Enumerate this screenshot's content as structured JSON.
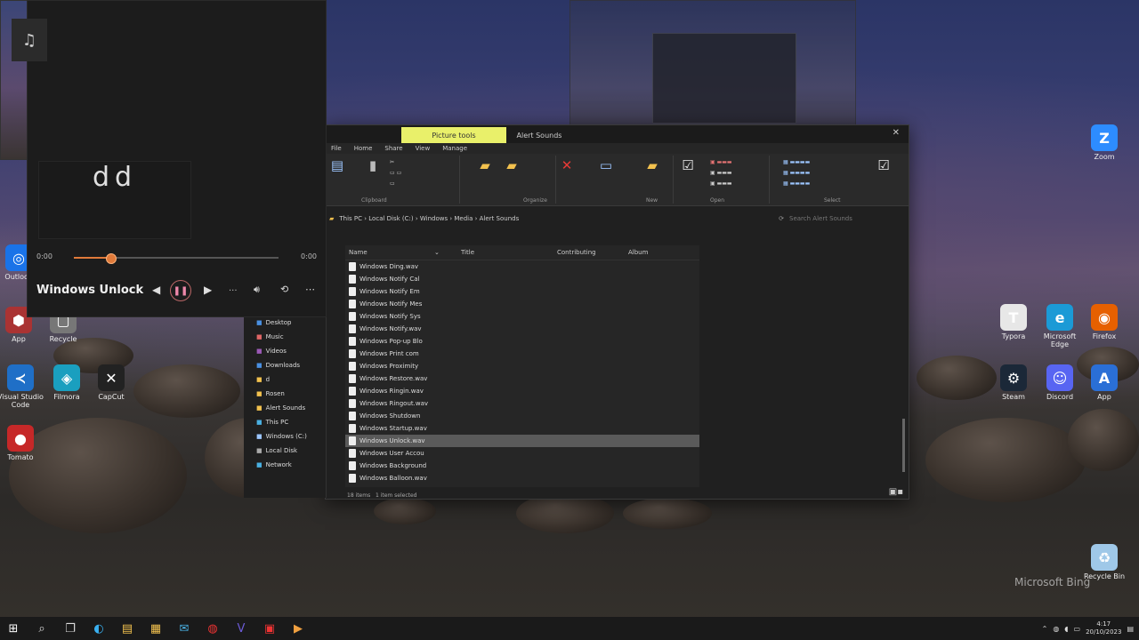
{
  "media_player": {
    "album_art_glyph": "♫",
    "lyrics_text": "dd",
    "time_elapsed": "0:00",
    "time_total": "0:00",
    "progress_fraction": 0.18,
    "track_title": "Windows Unlock",
    "more_label": "..."
  },
  "explorer": {
    "active_tab_label": "Picture tools",
    "other_tab_label": "Alert Sounds",
    "ribbon_tabs": [
      "File",
      "Home",
      "Share",
      "View",
      "Manage"
    ],
    "ribbon_groups": [
      "Clipboard",
      "Organize",
      "New",
      "Open",
      "Select"
    ],
    "address_parts": [
      "This PC",
      "Local Disk (C:)",
      "Windows",
      "Media",
      "Alert Sounds"
    ],
    "search_placeholder": "Search Alert Sounds",
    "columns": [
      "Name",
      "Title",
      "Contributing",
      "Album"
    ],
    "files": [
      "Windows Ding.wav",
      "Windows Notify Cal",
      "Windows Notify Em",
      "Windows Notify Mes",
      "Windows Notify Sys",
      "Windows Notify.wav",
      "Windows Pop-up Blo",
      "Windows Print com",
      "Windows Proximity",
      "Windows Restore.wav",
      "Windows Ringin.wav",
      "Windows Ringout.wav",
      "Windows Shutdown",
      "Windows Startup.wav",
      "Windows Unlock.wav",
      "Windows User Accou",
      "Windows Background",
      "Windows Balloon.wav"
    ],
    "selected_index": 14,
    "status_left": "18 items",
    "status_right": "1 item selected"
  },
  "nav_items": [
    "Desktop",
    "Music",
    "Videos",
    "Downloads",
    "d",
    "Rosen",
    "Alert Sounds",
    "This PC",
    "Windows (C:)",
    "Local Disk",
    "Network"
  ],
  "desktop_icons_left": [
    {
      "label": "Outlook",
      "glyph": "◎",
      "color": "#1a73e8"
    },
    {
      "label": "App",
      "glyph": "⬢",
      "color": "#a33"
    },
    {
      "label": "Recycle",
      "glyph": "▢",
      "color": "#777"
    },
    {
      "label": "Visual Studio Code",
      "glyph": "≺",
      "color": "#1f6fc7"
    },
    {
      "label": "Filmora",
      "glyph": "◈",
      "color": "#1a9fbf"
    },
    {
      "label": "CapCut",
      "glyph": "✕",
      "color": "#222"
    },
    {
      "label": "Tomato",
      "glyph": "●",
      "color": "#c62828"
    }
  ],
  "desktop_icons_right": [
    {
      "label": "Zoom",
      "glyph": "Z",
      "color": "#2d8cff"
    },
    {
      "label": "Typora",
      "glyph": "T",
      "color": "#e7e7e7"
    },
    {
      "label": "Microsoft Edge",
      "glyph": "e",
      "color": "#1b9ad6"
    },
    {
      "label": "Firefox",
      "glyph": "◉",
      "color": "#e66000"
    },
    {
      "label": "Steam",
      "glyph": "⚙",
      "color": "#1b2838"
    },
    {
      "label": "Discord",
      "glyph": "☺",
      "color": "#5865f2"
    },
    {
      "label": "App",
      "glyph": "A",
      "color": "#2a6fd6"
    },
    {
      "label": "Recycle Bin",
      "glyph": "♻",
      "color": "#9fc8e8"
    }
  ],
  "watermark": "Microsoft Bing",
  "taskbar": {
    "apps": [
      "⊞",
      "⌕",
      "❐",
      "◐",
      "▤",
      "▦",
      "✉",
      "◍",
      "V",
      "▣",
      "▶"
    ],
    "clock_time": "4:17",
    "clock_date": "20/10/2023"
  }
}
